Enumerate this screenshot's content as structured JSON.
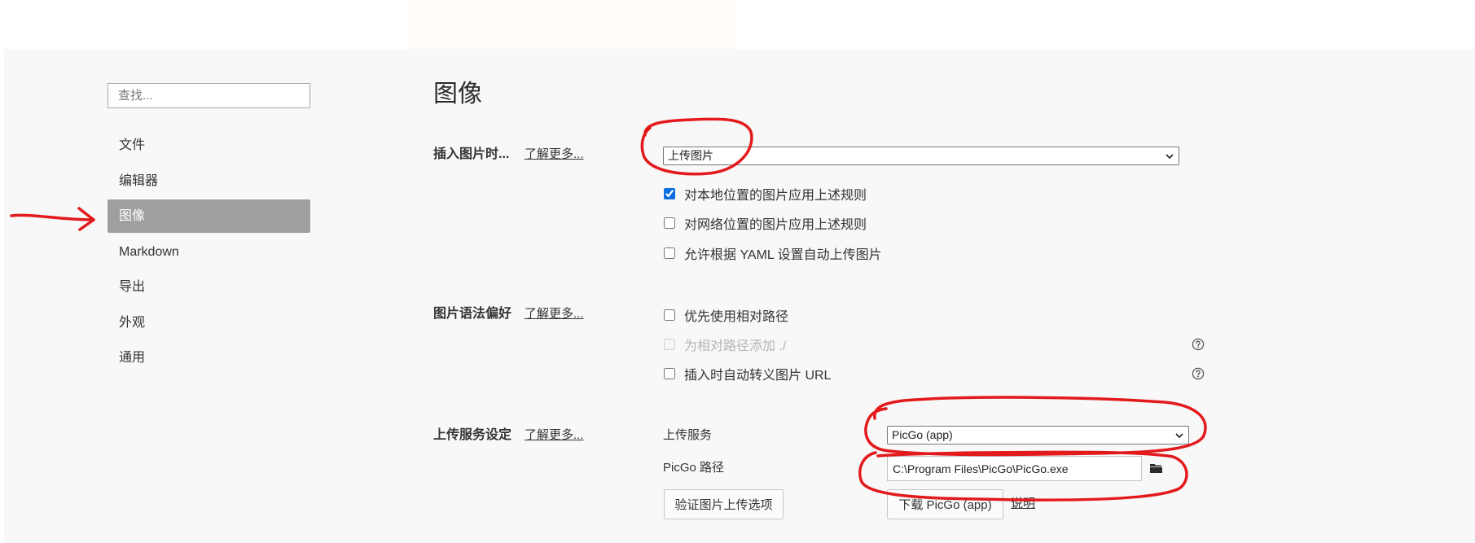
{
  "colors": {
    "panel_background": "#f8f8f8",
    "sidebar_selected_bg": "#9f9f9f",
    "checkbox_accent": "#0b6fe0",
    "annotation_red": "#e31a1c"
  },
  "sidebar": {
    "search": {
      "placeholder": "查找..."
    },
    "items": [
      {
        "label": "文件"
      },
      {
        "label": "编辑器"
      },
      {
        "label": "图像",
        "selected": true
      },
      {
        "label": "Markdown"
      },
      {
        "label": "导出"
      },
      {
        "label": "外观"
      },
      {
        "label": "通用"
      }
    ]
  },
  "main": {
    "title": "图像",
    "insert_section": {
      "label": "插入图片时...",
      "learn_more": "了解更多...",
      "action_select": {
        "value": "上传图片"
      },
      "options": [
        {
          "label": "对本地位置的图片应用上述规则",
          "checked": true
        },
        {
          "label": "对网络位置的图片应用上述规则",
          "checked": false
        },
        {
          "label": "允许根据 YAML 设置自动上传图片",
          "checked": false
        }
      ]
    },
    "syntax_section": {
      "label": "图片语法偏好",
      "learn_more": "了解更多...",
      "options": [
        {
          "label": "优先使用相对路径",
          "checked": false,
          "disabled": false
        },
        {
          "label": "为相对路径添加 ./",
          "checked": false,
          "disabled": true,
          "icon": "help-icon"
        },
        {
          "label": "插入时自动转义图片 URL",
          "checked": false,
          "disabled": false,
          "icon": "help-icon"
        }
      ]
    },
    "upload_section": {
      "label": "上传服务设定",
      "learn_more": "了解更多...",
      "service_label": "上传服务",
      "service_select": {
        "value": "PicGo (app)"
      },
      "path_label": "PicGo 路径",
      "path_value": "C:\\Program Files\\PicGo\\PicGo.exe",
      "browse_icon": "folder-icon",
      "verify_button": "验证图片上传选项",
      "download_button": "下载 PicGo (app)",
      "help_link": "说明"
    }
  }
}
